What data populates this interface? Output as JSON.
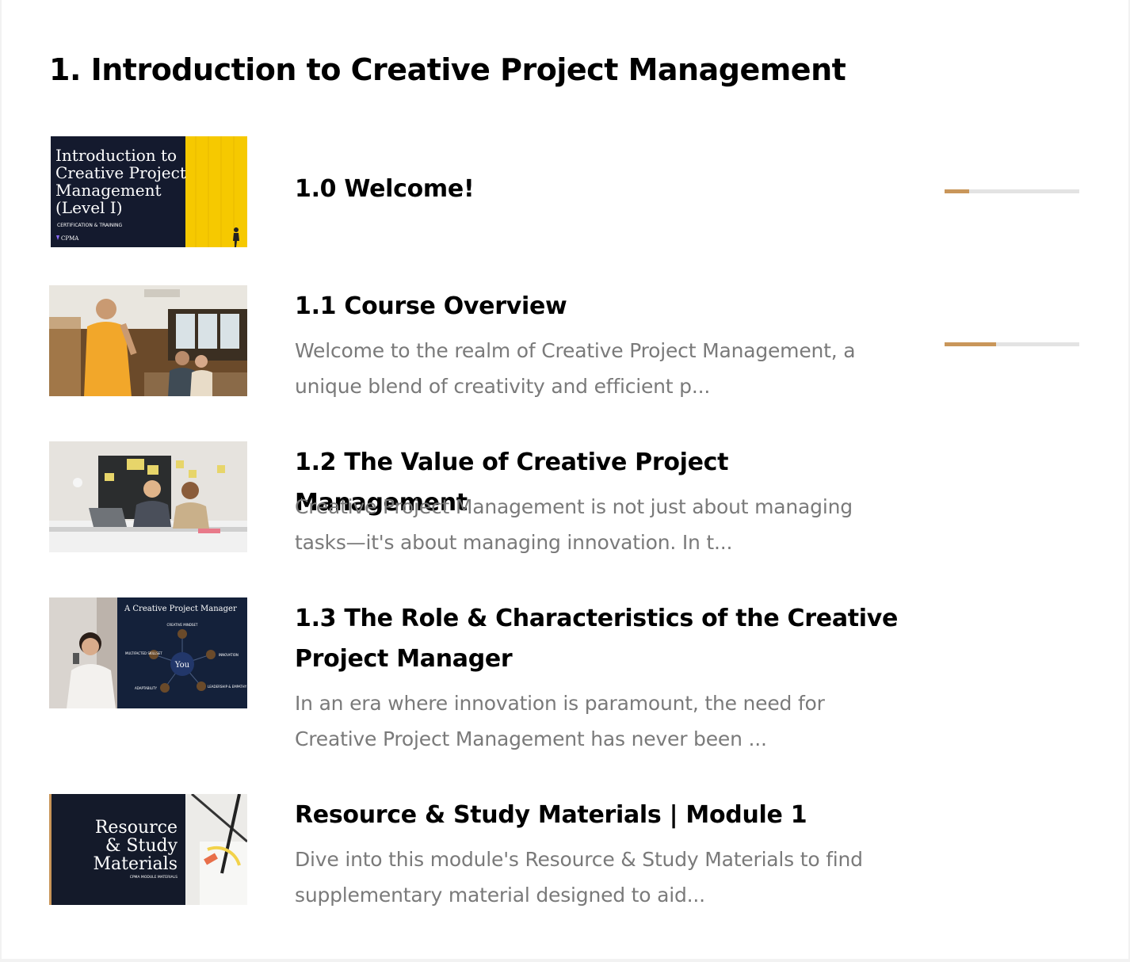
{
  "module": {
    "title": "1. Introduction to Creative Project Management"
  },
  "colors": {
    "progress_fill": "#c9965a",
    "progress_track": "#e3e3e3",
    "description_text": "#7a7a7a"
  },
  "lessons": [
    {
      "title": "1.0 Welcome!",
      "description": "",
      "progress_fraction": 0.18,
      "thumbnail": {
        "text_lines": [
          "Introduction to",
          "Creative Project",
          "Management",
          "(Level I)"
        ],
        "subtitle": "CERTIFICATION & TRAINING",
        "logo": "CPMA"
      }
    },
    {
      "title": "1.1 Course Overview",
      "description": "Welcome to the realm of Creative Project Management, a unique blend of creativity and efficient p...",
      "progress_fraction": 0.38,
      "thumbnail": {
        "icon": "office-team-photo-icon"
      }
    },
    {
      "title": "1.2 The Value of Creative Project Management",
      "description": "Creative Project Management is not just about managing tasks—it's about managing innovation. In t...",
      "thumbnail": {
        "icon": "two-people-laptop-photo-icon"
      }
    },
    {
      "title": "1.3 The Role & Characteristics of the Creative Project Manager",
      "description": "In an era where innovation is paramount, the need for Creative Project Management has never been ...",
      "thumbnail": {
        "heading": "A Creative Project Manager",
        "center": "You",
        "labels": [
          "CREATIVE MINDSET",
          "INNOVATION",
          "LEADERSHIP & EMPATHY",
          "ADAPTABILITY",
          "MULTIFACTED SKILLSET"
        ]
      }
    },
    {
      "title": "Resource & Study Materials | Module 1",
      "description": "Dive into this module's Resource & Study Materials to find supplementary material designed to aid...",
      "thumbnail": {
        "text_lines": [
          "Resource",
          "& Study",
          "Materials"
        ],
        "subtitle": "CPMA MODULE MATERIALS"
      }
    }
  ]
}
